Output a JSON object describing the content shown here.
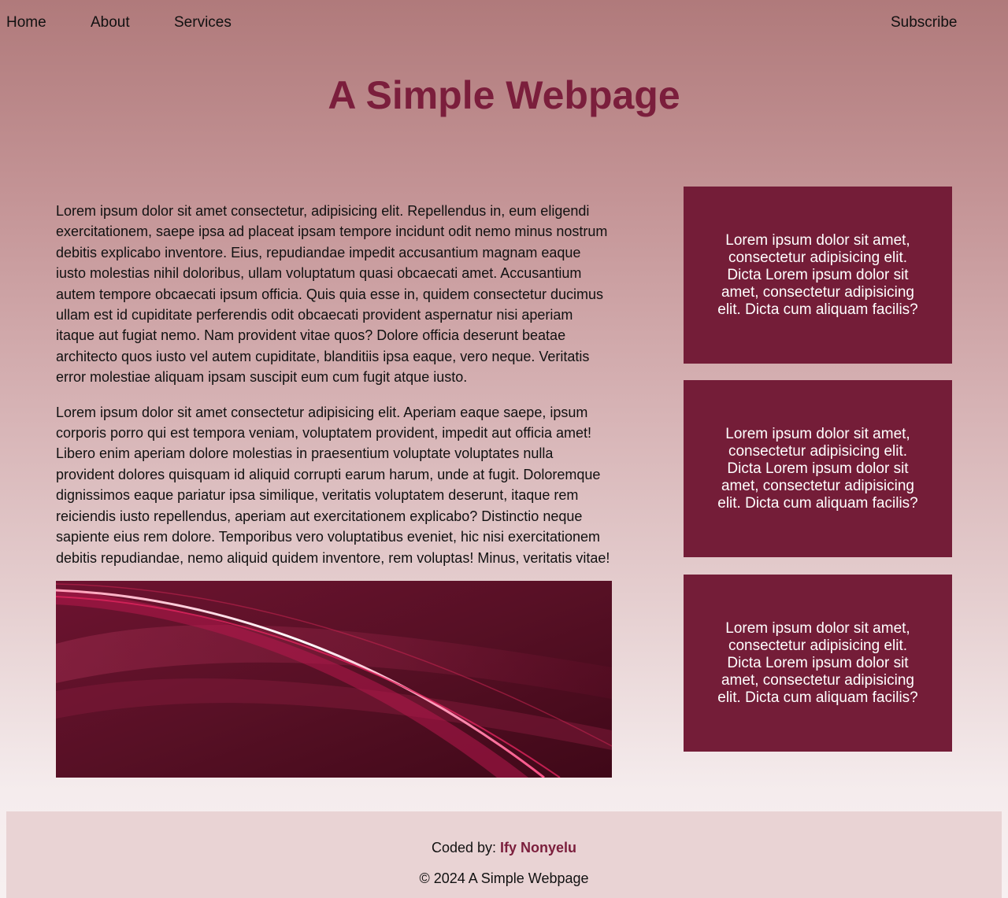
{
  "nav": {
    "home": "Home",
    "about": "About",
    "services": "Services",
    "subscribe": "Subscribe"
  },
  "page_title": "A Simple Webpage",
  "main": {
    "paragraphs": [
      "Lorem ipsum dolor sit amet consectetur, adipisicing elit. Repellendus in, eum eligendi exercitationem, saepe ipsa ad placeat ipsam tempore incidunt odit nemo minus nostrum debitis explicabo inventore. Eius, repudiandae impedit accusantium magnam eaque iusto molestias nihil doloribus, ullam voluptatum quasi obcaecati amet. Accusantium autem tempore obcaecati ipsum officia. Quis quia esse in, quidem consectetur ducimus ullam est id cupiditate perferendis odit obcaecati provident aspernatur nisi aperiam itaque aut fugiat nemo. Nam provident vitae quos? Dolore officia deserunt beatae architecto quos iusto vel autem cupiditate, blanditiis ipsa eaque, vero neque. Veritatis error molestiae aliquam ipsam suscipit eum cum fugit atque iusto.",
      "Lorem ipsum dolor sit amet consectetur adipisicing elit. Aperiam eaque saepe, ipsum corporis porro qui est tempora veniam, voluptatem provident, impedit aut officia amet! Libero enim aperiam dolore molestias in praesentium voluptate voluptates nulla provident dolores quisquam id aliquid corrupti earum harum, unde at fugit. Doloremque dignissimos eaque pariatur ipsa similique, veritatis voluptatem deserunt, itaque rem reiciendis iusto repellendus, aperiam aut exercitationem explicabo? Distinctio neque sapiente eius rem dolore. Temporibus vero voluptatibus eveniet, hic nisi exercitationem debitis repudiandae, nemo aliquid quidem inventore, rem voluptas! Minus, veritatis vitae!"
    ]
  },
  "sidebar": {
    "cards": [
      "Lorem ipsum dolor sit amet, consectetur adipisicing elit. Dicta Lorem ipsum dolor sit amet, consectetur adipisicing elit. Dicta cum aliquam facilis?",
      "Lorem ipsum dolor sit amet, consectetur adipisicing elit. Dicta Lorem ipsum dolor sit amet, consectetur adipisicing elit. Dicta cum aliquam facilis?",
      "Lorem ipsum dolor sit amet, consectetur adipisicing elit. Dicta Lorem ipsum dolor sit amet, consectetur adipisicing elit. Dicta cum aliquam facilis?"
    ]
  },
  "footer": {
    "coded_by_label": "Coded by: ",
    "author": "Ify Nonyelu",
    "copyright": "© 2024 A Simple Webpage"
  },
  "colors": {
    "accent": "#7b1e3c",
    "card_background": "#741d38",
    "footer_background": "#e9d3d4"
  }
}
